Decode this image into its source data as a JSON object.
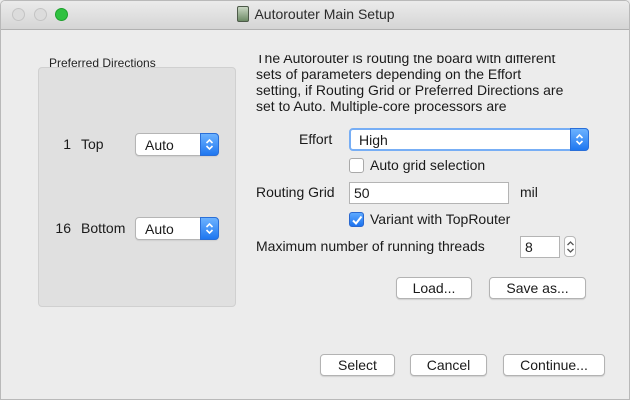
{
  "window": {
    "title": "Autorouter Main Setup"
  },
  "preferred_directions": {
    "label": "Preferred Directions",
    "layers": [
      {
        "number": "1",
        "name": "Top",
        "value": "Auto"
      },
      {
        "number": "16",
        "name": "Bottom",
        "value": "Auto"
      }
    ]
  },
  "description": {
    "line1": "The Autorouter is routing the board with different",
    "line2": "sets of parameters depending on the Effort",
    "line3": "setting, if Routing Grid or Preferred Directions are",
    "line4": "set to Auto. Multiple-core processors are"
  },
  "effort": {
    "label": "Effort",
    "value": "High"
  },
  "auto_grid": {
    "label": "Auto grid selection",
    "checked": false
  },
  "routing_grid": {
    "label": "Routing Grid",
    "value": "50",
    "unit": "mil"
  },
  "variant": {
    "label": "Variant with TopRouter",
    "checked": true
  },
  "threads": {
    "label": "Maximum number of running threads",
    "value": "8"
  },
  "buttons": {
    "load": "Load...",
    "save_as": "Save as...",
    "select": "Select",
    "cancel": "Cancel",
    "continue": "Continue..."
  },
  "colors": {
    "accent": "#1f77f0",
    "window_bg": "#ececec",
    "group_bg": "#e0e0e0"
  }
}
